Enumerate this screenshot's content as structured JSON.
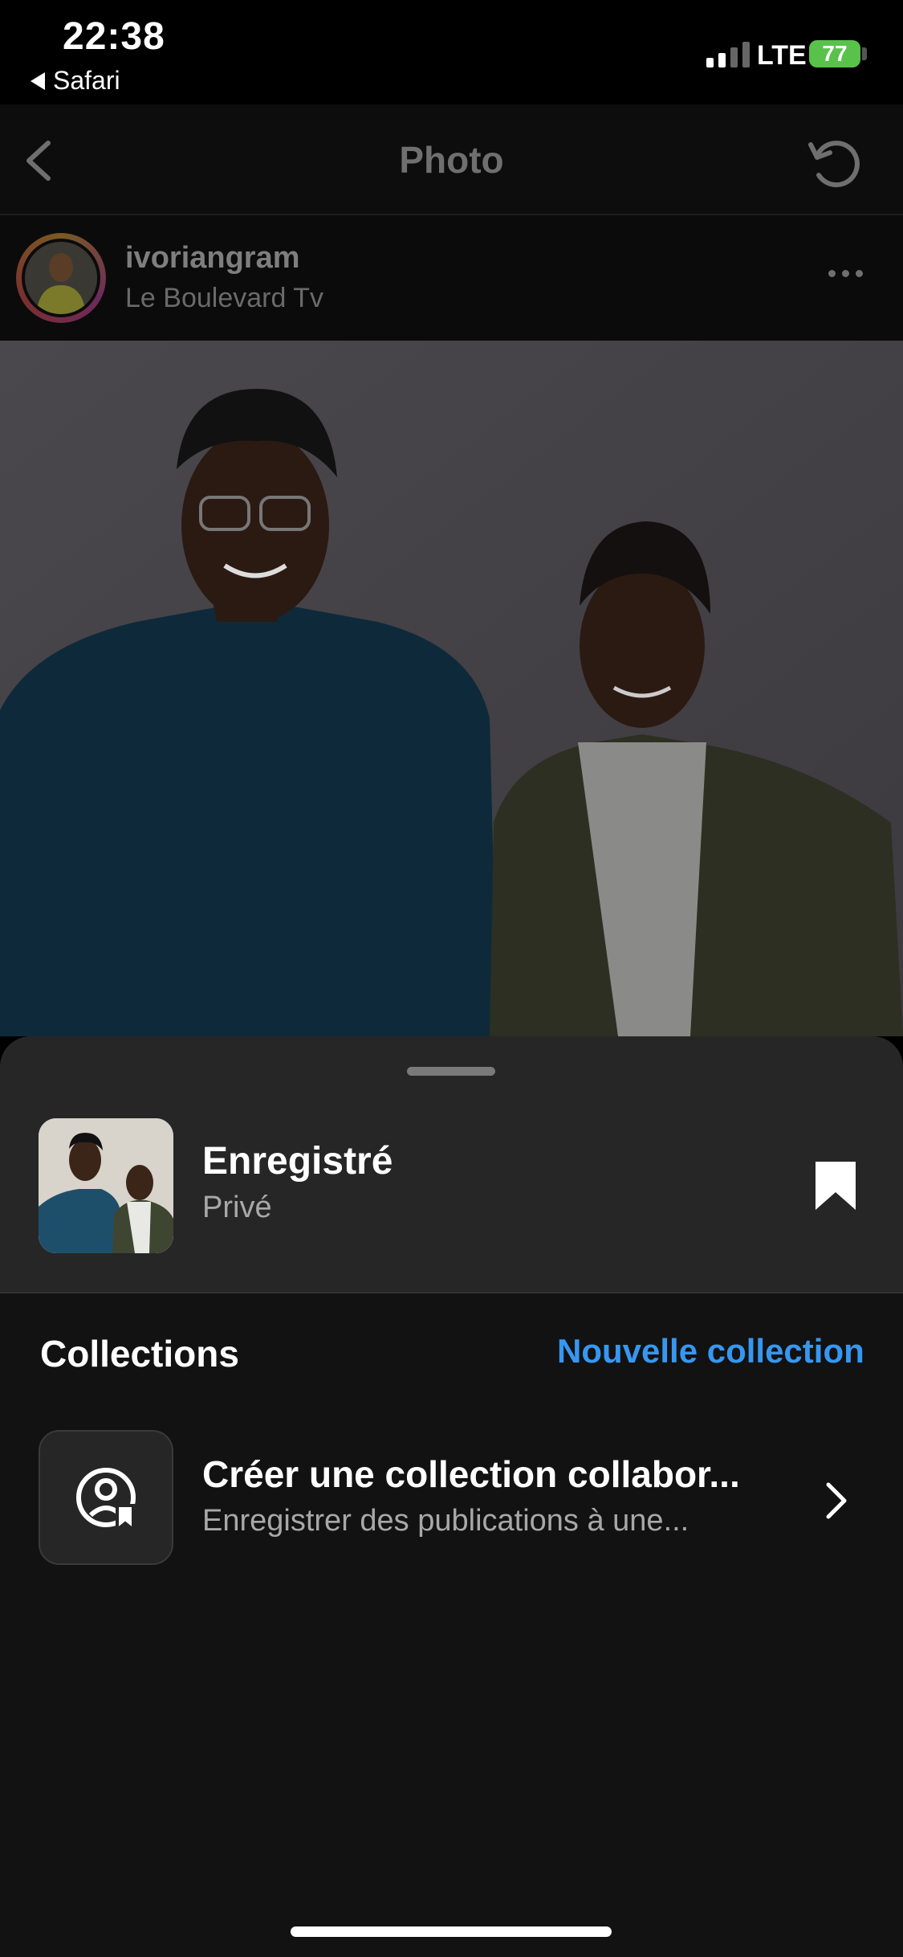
{
  "status_bar": {
    "time": "22:38",
    "back_app": "Safari",
    "network": "LTE",
    "battery": "77"
  },
  "nav": {
    "title": "Photo",
    "back_icon": "chevron-left-icon",
    "refresh_icon": "refresh-icon"
  },
  "post": {
    "username": "ivoriangram",
    "subtitle": "Le Boulevard Tv"
  },
  "sheet": {
    "saved_title": "Enregistré",
    "saved_sub": "Privé",
    "collections_heading": "Collections",
    "new_collection": "Nouvelle collection",
    "collab": {
      "title": "Créer une collection collabor...",
      "subtitle": "Enregistrer des publications à une..."
    }
  },
  "colors": {
    "accent": "#3797f0",
    "sheet_bg": "#121212",
    "sheet_top_bg": "#262626",
    "battery": "#58c24a"
  }
}
